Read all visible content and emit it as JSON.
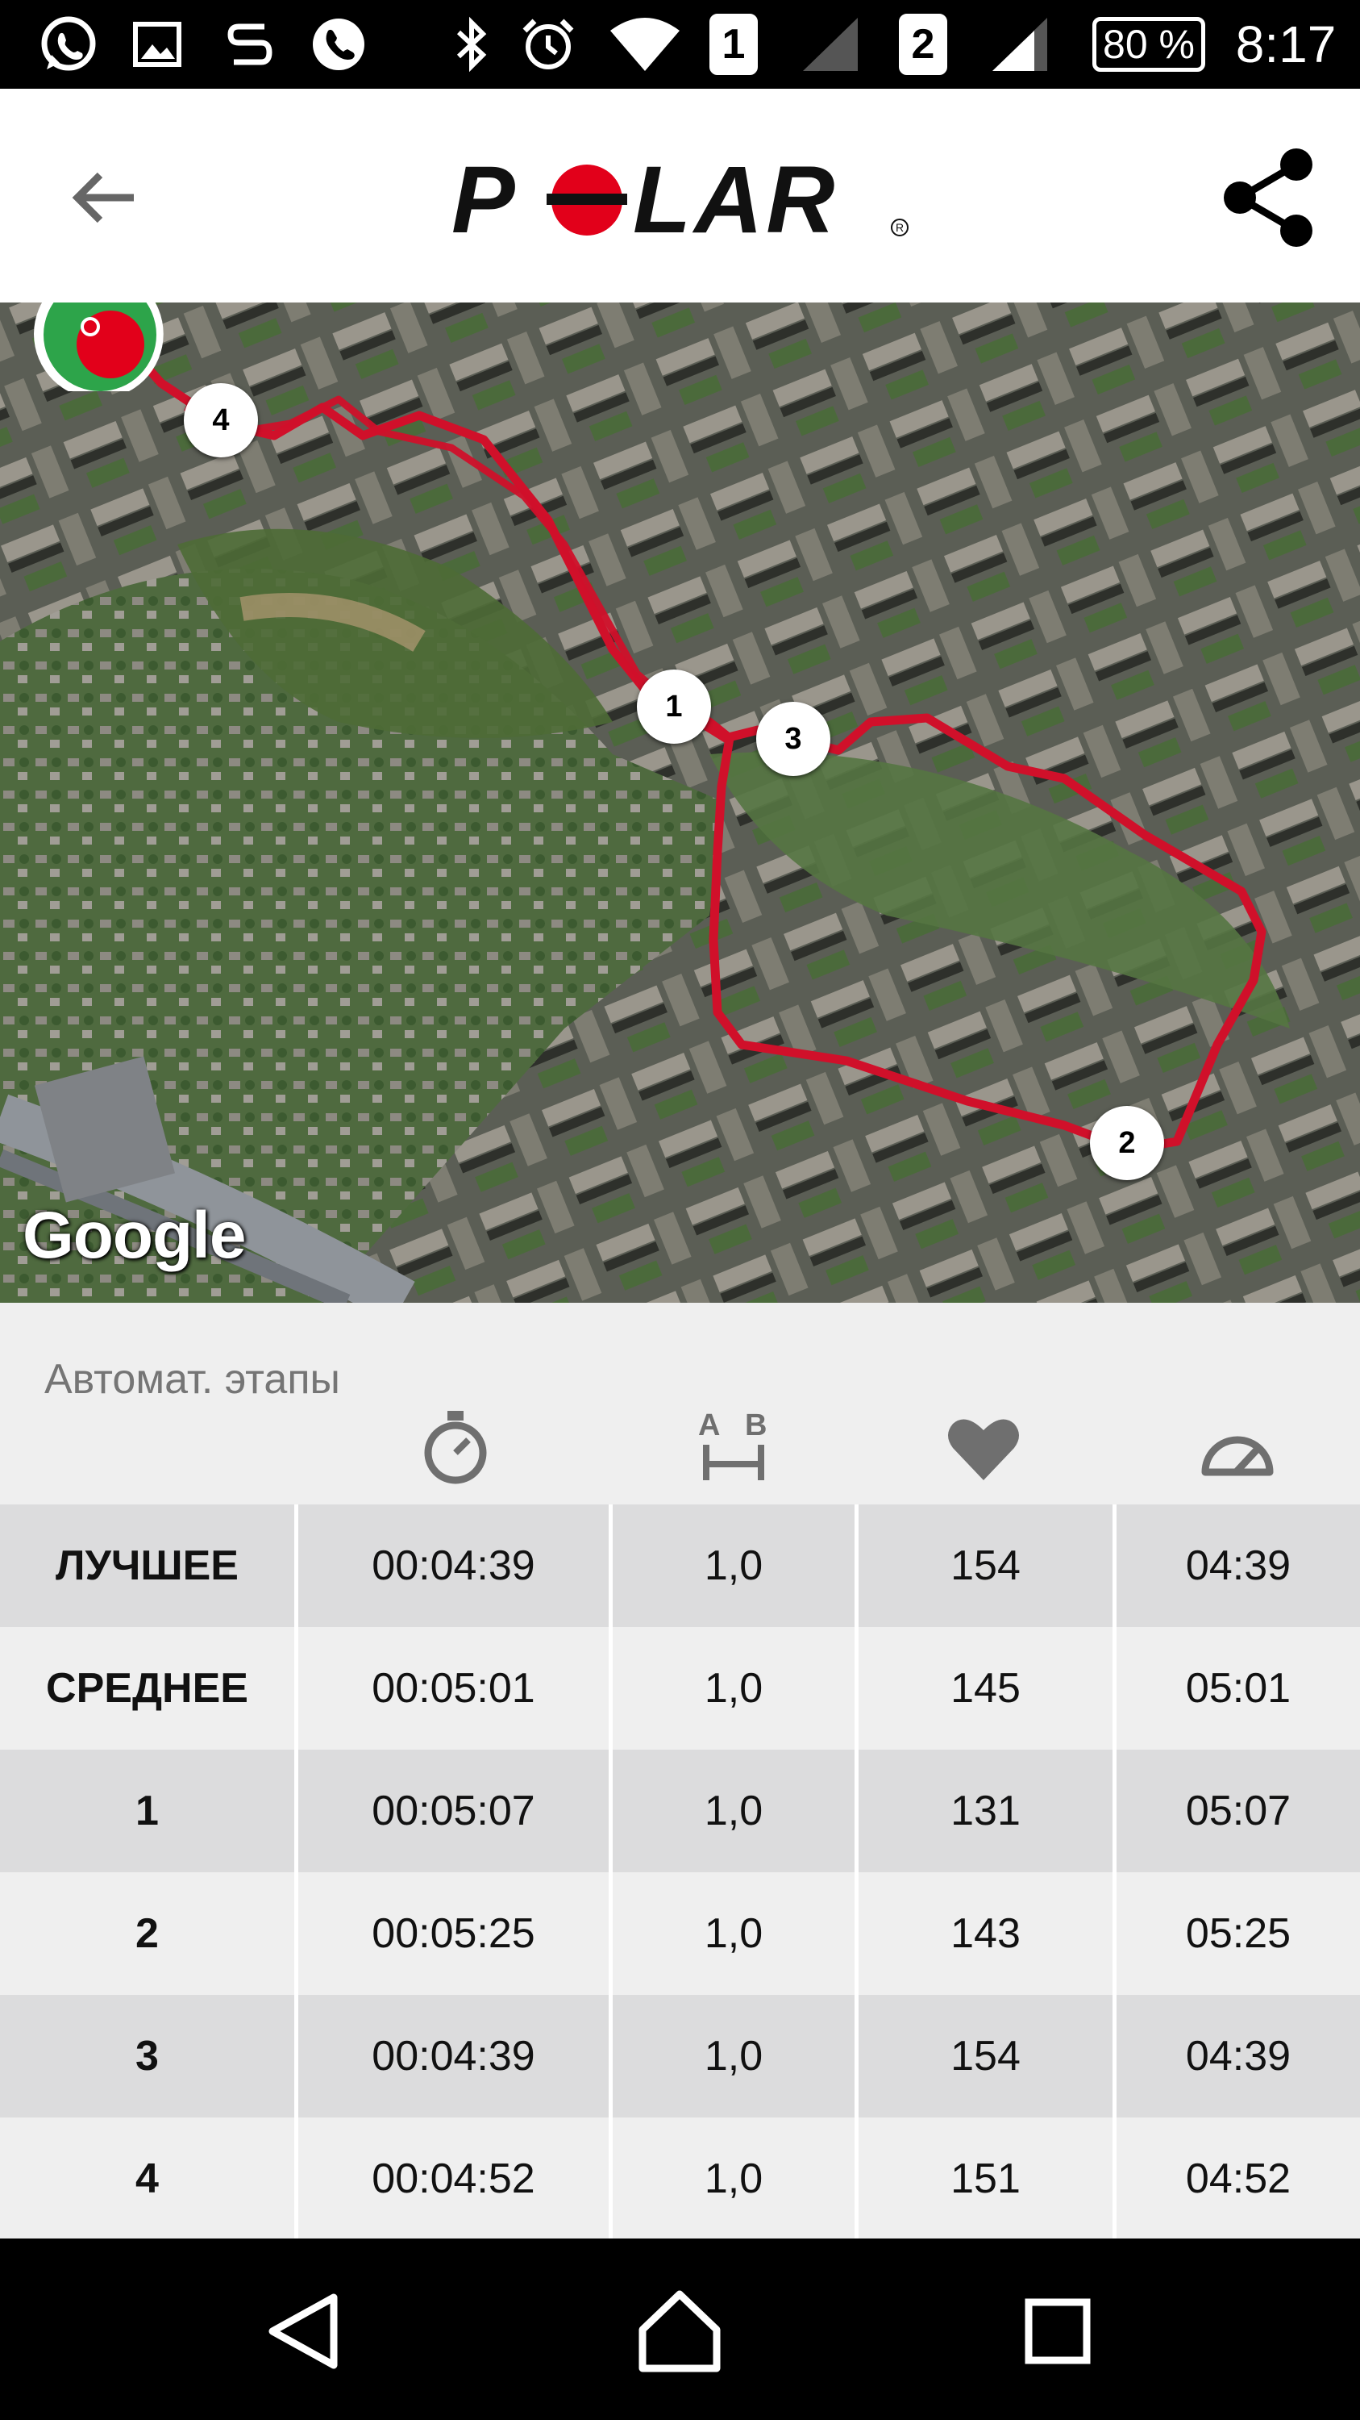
{
  "status_bar": {
    "sim1": "1",
    "sim2": "2",
    "battery": "80 %",
    "time": "8:17"
  },
  "app_bar": {
    "logo_text": "POLAR",
    "brand_color": "#e2001a"
  },
  "map": {
    "attribution": "Google",
    "route_color": "#d0102a",
    "lap_markers": [
      "1",
      "2",
      "3",
      "4"
    ]
  },
  "laps": {
    "title": "Автомат. этапы",
    "columns": [
      "",
      "stopwatch-icon",
      "distance-ab-icon",
      "heart-icon",
      "speedometer-icon"
    ],
    "rows": [
      {
        "label": "ЛУЧШЕЕ",
        "time": "00:04:39",
        "distance": "1,0",
        "hr": "154",
        "pace": "04:39"
      },
      {
        "label": "СРЕДНЕЕ",
        "time": "00:05:01",
        "distance": "1,0",
        "hr": "145",
        "pace": "05:01"
      },
      {
        "label": "1",
        "time": "00:05:07",
        "distance": "1,0",
        "hr": "131",
        "pace": "05:07"
      },
      {
        "label": "2",
        "time": "00:05:25",
        "distance": "1,0",
        "hr": "143",
        "pace": "05:25"
      },
      {
        "label": "3",
        "time": "00:04:39",
        "distance": "1,0",
        "hr": "154",
        "pace": "04:39"
      },
      {
        "label": "4",
        "time": "00:04:52",
        "distance": "1,0",
        "hr": "151",
        "pace": "04:52"
      }
    ]
  }
}
